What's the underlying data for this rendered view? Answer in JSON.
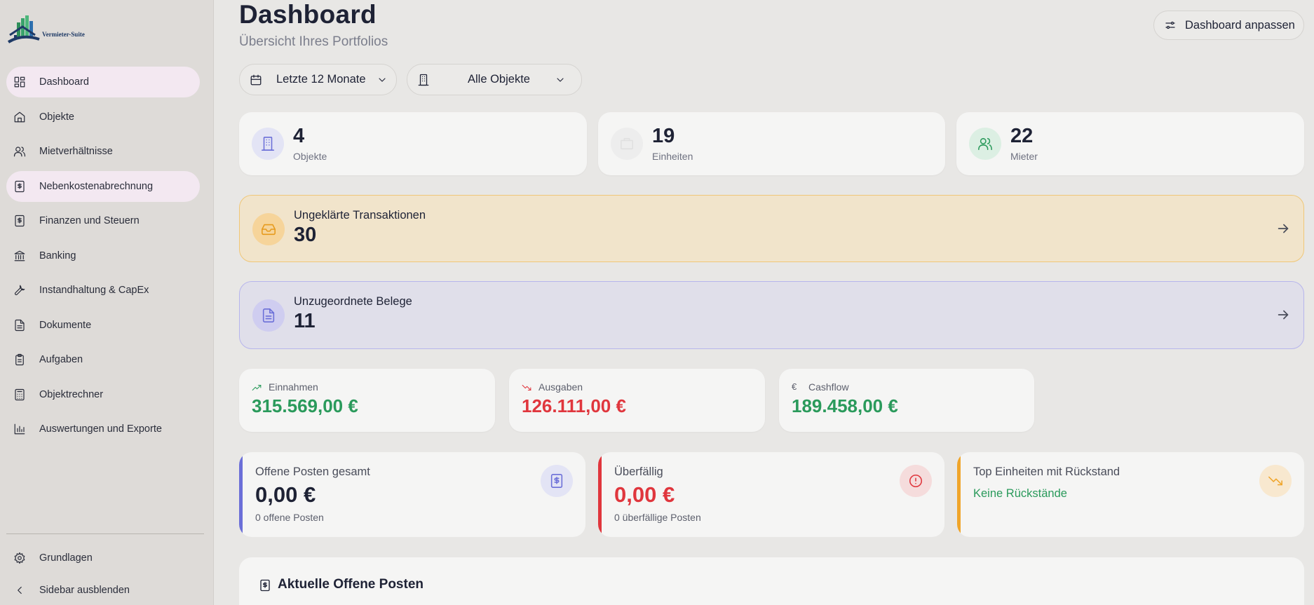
{
  "app": {
    "logo_text": "Vermieter-Suite"
  },
  "sidebar": {
    "items": [
      {
        "label": "Dashboard",
        "icon": "layout-grid-icon",
        "active": true
      },
      {
        "label": "Objekte",
        "icon": "home-icon",
        "active": false
      },
      {
        "label": "Mietverhältnisse",
        "icon": "users-icon",
        "active": false
      },
      {
        "label": "Nebenkostenabrechnung",
        "icon": "receipt-icon",
        "active": true
      },
      {
        "label": "Finanzen und Steuern",
        "icon": "dollar-file-icon",
        "active": false
      },
      {
        "label": "Banking",
        "icon": "bank-icon",
        "active": false
      },
      {
        "label": "Instandhaltung & CapEx",
        "icon": "wrench-icon",
        "active": false
      },
      {
        "label": "Dokumente",
        "icon": "document-icon",
        "active": false
      },
      {
        "label": "Aufgaben",
        "icon": "clipboard-icon",
        "active": false
      },
      {
        "label": "Objektrechner",
        "icon": "calculator-icon",
        "active": false
      },
      {
        "label": "Auswertungen und Exporte",
        "icon": "bar-chart-icon",
        "active": false
      }
    ],
    "bottom": [
      {
        "label": "Grundlagen",
        "icon": "gear-icon"
      },
      {
        "label": "Sidebar ausblenden",
        "icon": "chevron-left-icon"
      }
    ]
  },
  "header": {
    "title": "Dashboard",
    "subtitle": "Übersicht Ihres Portfolios",
    "customize_label": "Dashboard anpassen"
  },
  "filters": {
    "period": "Letzte 12 Monate",
    "objects": "Alle Objekte"
  },
  "stats": [
    {
      "value": "4",
      "label": "Objekte",
      "icon": "building-icon"
    },
    {
      "value": "19",
      "label": "Einheiten",
      "icon": "units-icon"
    },
    {
      "value": "22",
      "label": "Mieter",
      "icon": "users-icon"
    }
  ],
  "alerts": {
    "transactions": {
      "title": "Ungeklärte Transaktionen",
      "value": "30"
    },
    "receipts": {
      "title": "Unzugeordnete Belege",
      "value": "11"
    }
  },
  "finance": {
    "income": {
      "label": "Einnahmen",
      "value": "315.569,00 €"
    },
    "expenses": {
      "label": "Ausgaben",
      "value": "126.111,00 €"
    },
    "cashflow": {
      "label": "Cashflow",
      "value": "189.458,00 €",
      "symbol": "€"
    }
  },
  "open_items": {
    "total": {
      "title": "Offene Posten gesamt",
      "value": "0,00 €",
      "sub": "0 offene Posten"
    },
    "overdue": {
      "title": "Überfällig",
      "value": "0,00 €",
      "sub": "0 überfällige Posten"
    },
    "top_units": {
      "title": "Top Einheiten mit Rückstand",
      "value": "Keine Rückstände"
    }
  },
  "bottom": {
    "title": "Aktuelle Offene Posten"
  },
  "colors": {
    "green": "#2a9a5b",
    "red": "#e0363d",
    "indigo": "#6b6fd8",
    "orange": "#f0a52a"
  }
}
